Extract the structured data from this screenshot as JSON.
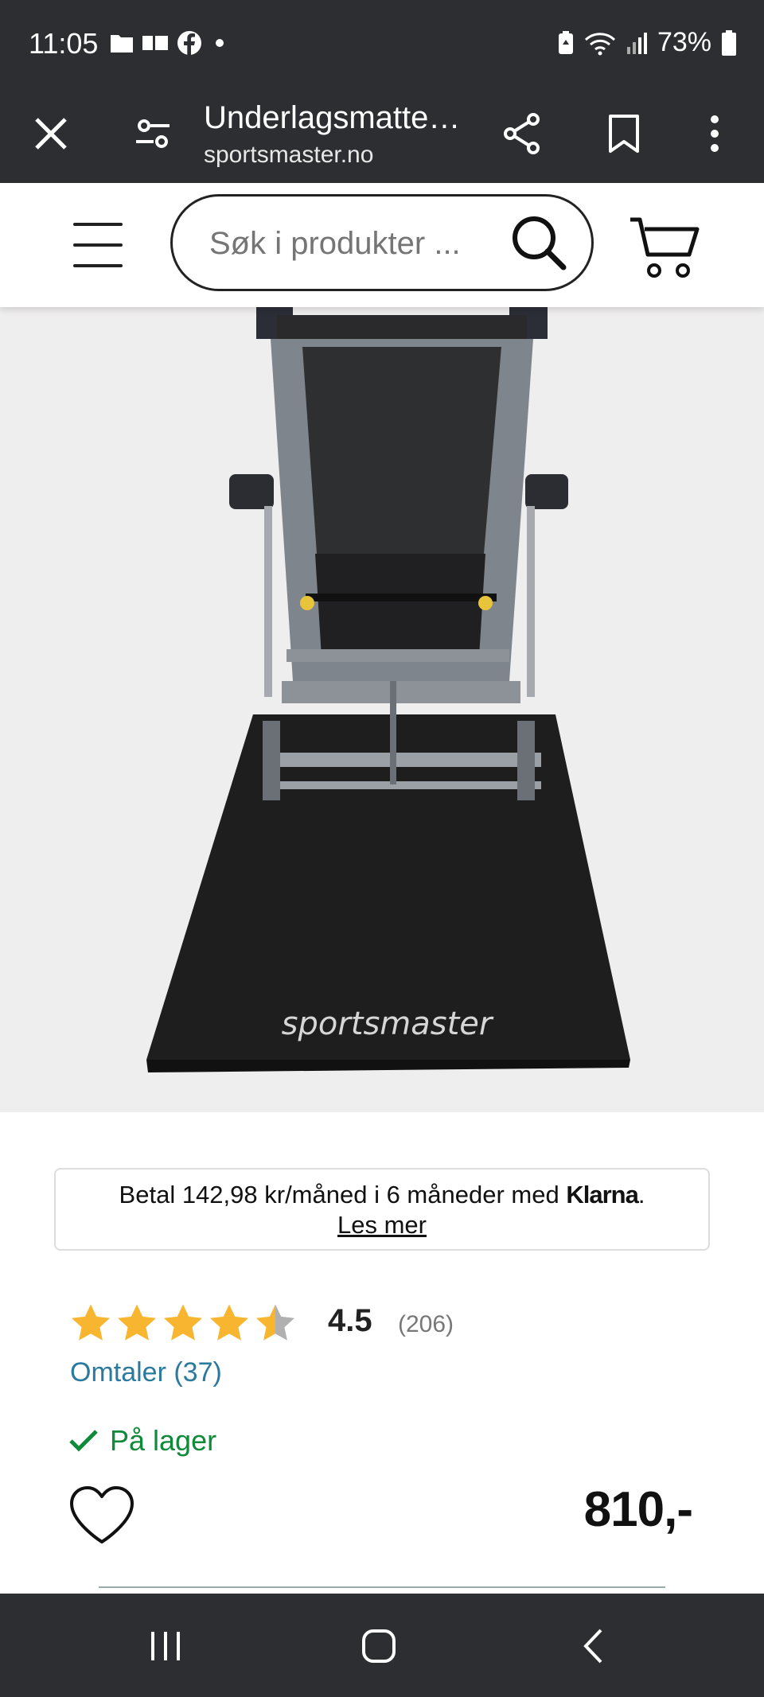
{
  "status_bar": {
    "time": "11:05",
    "battery": "73%",
    "icons": [
      "folder-icon",
      "gallery-icon",
      "facebook-icon",
      "dot-icon",
      "battery-saver-icon",
      "wifi-icon",
      "signal-icon",
      "battery-icon"
    ]
  },
  "browser": {
    "page_title": "Underlagsmatte…",
    "url": "sportsmaster.no",
    "icons": [
      "close-icon",
      "site-settings-icon",
      "share-icon",
      "bookmark-icon",
      "more-vert-icon"
    ]
  },
  "site_header": {
    "search_placeholder": "Søk i produkter ...",
    "icons": [
      "menu-icon",
      "search-icon",
      "cart-icon"
    ]
  },
  "product_image": {
    "brand_text": "sportsmaster",
    "description": "Treadmill standing on a black floor mat"
  },
  "klarna": {
    "text": "Betal 142,98 kr/måned i 6 måneder med ",
    "brand": "Klarna",
    "punct": ".",
    "link": "Les mer"
  },
  "rating": {
    "stars_value": 4.5,
    "stars_max": 5,
    "value": "4.5",
    "count": "(206)",
    "reviews_link": "Omtaler (37)"
  },
  "stock": {
    "label": "På lager"
  },
  "price": "810,-",
  "colors": {
    "chrome_bg": "#2d2e32",
    "star": "#f8b630",
    "star_empty": "#b0b0b0",
    "link": "#2a7aa0",
    "stock": "#0e8a3a"
  }
}
